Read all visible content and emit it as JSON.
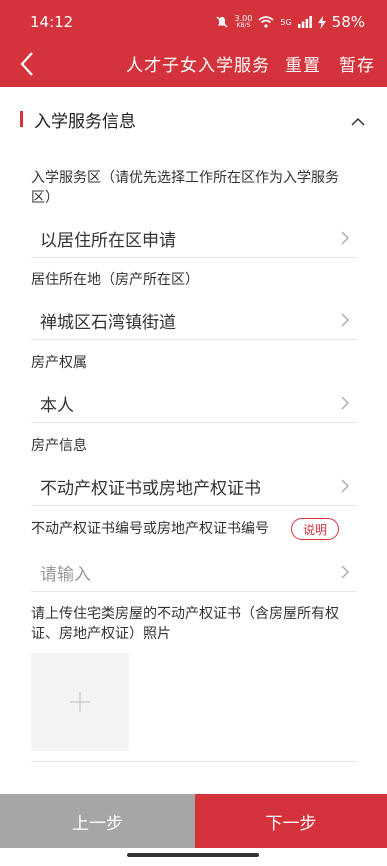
{
  "status_bar": {
    "time": "14:12",
    "network_speed": "3.00",
    "network_unit": "KB/S",
    "signal": "5G",
    "battery": "58%"
  },
  "navbar": {
    "title": "人才子女入学服务",
    "reset_label": "重置",
    "save_label": "暂存"
  },
  "section": {
    "title": "入学服务信息"
  },
  "fields": [
    {
      "label": "入学服务区（请优先选择工作所在区作为入学服务区）",
      "value": "以居住所在区申请"
    },
    {
      "label": "居住所在地（房产所在区）",
      "value": "禅城区石湾镇街道"
    },
    {
      "label": "房产权属",
      "value": "本人"
    },
    {
      "label": "房产信息",
      "value": "不动产权证书或房地产权证书"
    },
    {
      "label": "不动产权证书编号或房地产权证书编号",
      "placeholder": "请输入",
      "help_label": "说明"
    }
  ],
  "upload": {
    "label": "请上传住宅类房屋的不动产权证书（含房屋所有权证、房地产权证）照片"
  },
  "bottom": {
    "prev_label": "上一步",
    "next_label": "下一步"
  },
  "colors": {
    "brand": "#d4333b",
    "disabled_button": "#a6a6a6"
  }
}
